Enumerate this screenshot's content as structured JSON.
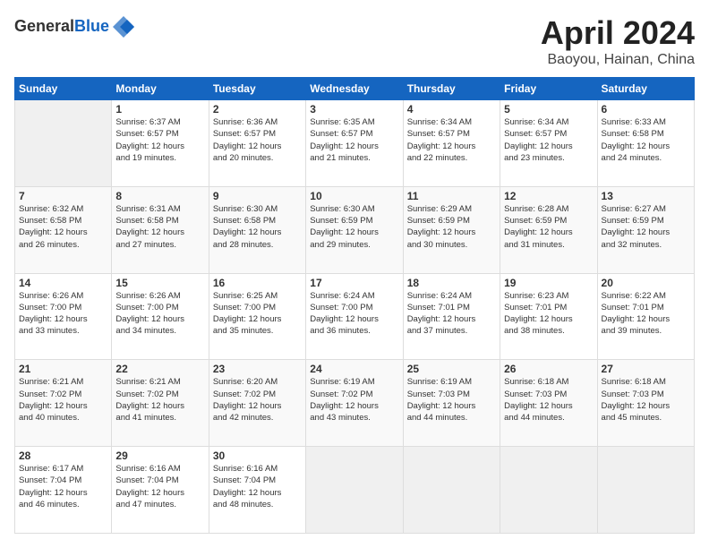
{
  "header": {
    "logo_line1": "General",
    "logo_line2": "Blue",
    "month_title": "April 2024",
    "location": "Baoyou, Hainan, China"
  },
  "weekdays": [
    "Sunday",
    "Monday",
    "Tuesday",
    "Wednesday",
    "Thursday",
    "Friday",
    "Saturday"
  ],
  "weeks": [
    [
      {
        "num": "",
        "info": ""
      },
      {
        "num": "1",
        "info": "Sunrise: 6:37 AM\nSunset: 6:57 PM\nDaylight: 12 hours\nand 19 minutes."
      },
      {
        "num": "2",
        "info": "Sunrise: 6:36 AM\nSunset: 6:57 PM\nDaylight: 12 hours\nand 20 minutes."
      },
      {
        "num": "3",
        "info": "Sunrise: 6:35 AM\nSunset: 6:57 PM\nDaylight: 12 hours\nand 21 minutes."
      },
      {
        "num": "4",
        "info": "Sunrise: 6:34 AM\nSunset: 6:57 PM\nDaylight: 12 hours\nand 22 minutes."
      },
      {
        "num": "5",
        "info": "Sunrise: 6:34 AM\nSunset: 6:57 PM\nDaylight: 12 hours\nand 23 minutes."
      },
      {
        "num": "6",
        "info": "Sunrise: 6:33 AM\nSunset: 6:58 PM\nDaylight: 12 hours\nand 24 minutes."
      }
    ],
    [
      {
        "num": "7",
        "info": "Sunrise: 6:32 AM\nSunset: 6:58 PM\nDaylight: 12 hours\nand 26 minutes."
      },
      {
        "num": "8",
        "info": "Sunrise: 6:31 AM\nSunset: 6:58 PM\nDaylight: 12 hours\nand 27 minutes."
      },
      {
        "num": "9",
        "info": "Sunrise: 6:30 AM\nSunset: 6:58 PM\nDaylight: 12 hours\nand 28 minutes."
      },
      {
        "num": "10",
        "info": "Sunrise: 6:30 AM\nSunset: 6:59 PM\nDaylight: 12 hours\nand 29 minutes."
      },
      {
        "num": "11",
        "info": "Sunrise: 6:29 AM\nSunset: 6:59 PM\nDaylight: 12 hours\nand 30 minutes."
      },
      {
        "num": "12",
        "info": "Sunrise: 6:28 AM\nSunset: 6:59 PM\nDaylight: 12 hours\nand 31 minutes."
      },
      {
        "num": "13",
        "info": "Sunrise: 6:27 AM\nSunset: 6:59 PM\nDaylight: 12 hours\nand 32 minutes."
      }
    ],
    [
      {
        "num": "14",
        "info": "Sunrise: 6:26 AM\nSunset: 7:00 PM\nDaylight: 12 hours\nand 33 minutes."
      },
      {
        "num": "15",
        "info": "Sunrise: 6:26 AM\nSunset: 7:00 PM\nDaylight: 12 hours\nand 34 minutes."
      },
      {
        "num": "16",
        "info": "Sunrise: 6:25 AM\nSunset: 7:00 PM\nDaylight: 12 hours\nand 35 minutes."
      },
      {
        "num": "17",
        "info": "Sunrise: 6:24 AM\nSunset: 7:00 PM\nDaylight: 12 hours\nand 36 minutes."
      },
      {
        "num": "18",
        "info": "Sunrise: 6:24 AM\nSunset: 7:01 PM\nDaylight: 12 hours\nand 37 minutes."
      },
      {
        "num": "19",
        "info": "Sunrise: 6:23 AM\nSunset: 7:01 PM\nDaylight: 12 hours\nand 38 minutes."
      },
      {
        "num": "20",
        "info": "Sunrise: 6:22 AM\nSunset: 7:01 PM\nDaylight: 12 hours\nand 39 minutes."
      }
    ],
    [
      {
        "num": "21",
        "info": "Sunrise: 6:21 AM\nSunset: 7:02 PM\nDaylight: 12 hours\nand 40 minutes."
      },
      {
        "num": "22",
        "info": "Sunrise: 6:21 AM\nSunset: 7:02 PM\nDaylight: 12 hours\nand 41 minutes."
      },
      {
        "num": "23",
        "info": "Sunrise: 6:20 AM\nSunset: 7:02 PM\nDaylight: 12 hours\nand 42 minutes."
      },
      {
        "num": "24",
        "info": "Sunrise: 6:19 AM\nSunset: 7:02 PM\nDaylight: 12 hours\nand 43 minutes."
      },
      {
        "num": "25",
        "info": "Sunrise: 6:19 AM\nSunset: 7:03 PM\nDaylight: 12 hours\nand 44 minutes."
      },
      {
        "num": "26",
        "info": "Sunrise: 6:18 AM\nSunset: 7:03 PM\nDaylight: 12 hours\nand 44 minutes."
      },
      {
        "num": "27",
        "info": "Sunrise: 6:18 AM\nSunset: 7:03 PM\nDaylight: 12 hours\nand 45 minutes."
      }
    ],
    [
      {
        "num": "28",
        "info": "Sunrise: 6:17 AM\nSunset: 7:04 PM\nDaylight: 12 hours\nand 46 minutes."
      },
      {
        "num": "29",
        "info": "Sunrise: 6:16 AM\nSunset: 7:04 PM\nDaylight: 12 hours\nand 47 minutes."
      },
      {
        "num": "30",
        "info": "Sunrise: 6:16 AM\nSunset: 7:04 PM\nDaylight: 12 hours\nand 48 minutes."
      },
      {
        "num": "",
        "info": ""
      },
      {
        "num": "",
        "info": ""
      },
      {
        "num": "",
        "info": ""
      },
      {
        "num": "",
        "info": ""
      }
    ]
  ]
}
